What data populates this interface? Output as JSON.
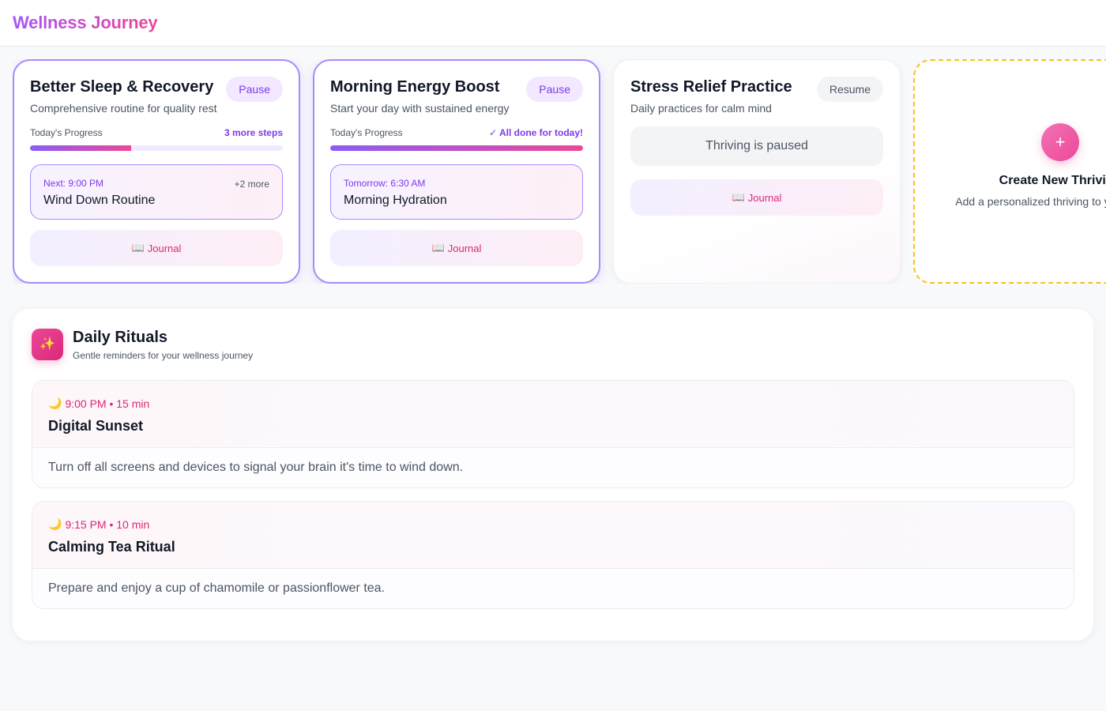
{
  "app": {
    "title": "Wellness Journey"
  },
  "thrivings": [
    {
      "title": "Better Sleep & Recovery",
      "subtitle": "Comprehensive routine for quality rest",
      "action_label": "Pause",
      "state": "active",
      "progress_label": "Today's Progress",
      "progress_status": "3 more steps",
      "progress_fraction": 0.4,
      "next_time": "Next: 9:00 PM",
      "next_more": "+2 more",
      "next_name": "Wind Down Routine",
      "journal_icon": "📖",
      "journal_label": "Journal"
    },
    {
      "title": "Morning Energy Boost",
      "subtitle": "Start your day with sustained energy",
      "action_label": "Pause",
      "state": "active",
      "progress_label": "Today's Progress",
      "progress_status": "✓ All done for today!",
      "progress_fraction": 1.0,
      "next_time": "Tomorrow: 6:30 AM",
      "next_more": "",
      "next_name": "Morning Hydration",
      "journal_icon": "📖",
      "journal_label": "Journal"
    },
    {
      "title": "Stress Relief Practice",
      "subtitle": "Daily practices for calm mind",
      "action_label": "Resume",
      "state": "paused",
      "paused_text": "Thriving is paused",
      "journal_icon": "📖",
      "journal_label": "Journal"
    }
  ],
  "create_card": {
    "plus": "+",
    "title": "Create New Thriving",
    "subtitle": "Add a personalized thriving to your journey"
  },
  "rituals": {
    "icon": "✨",
    "title": "Daily Rituals",
    "subtitle": "Gentle reminders for your wellness journey",
    "items": [
      {
        "icon": "🌙",
        "meta": "9:00 PM • 15 min",
        "name": "Digital Sunset",
        "description": "Turn off all screens and devices to signal your brain it's time to wind down."
      },
      {
        "icon": "🌙",
        "meta": "9:15 PM • 10 min",
        "name": "Calming Tea Ritual",
        "description": "Prepare and enjoy a cup of chamomile or passionflower tea."
      }
    ]
  },
  "colors": {
    "brand_start": "#a855f7",
    "brand_end": "#ec4899",
    "accent_purple": "#7c3aed",
    "accent_pink": "#db2777",
    "create_border": "#fbbf24"
  }
}
